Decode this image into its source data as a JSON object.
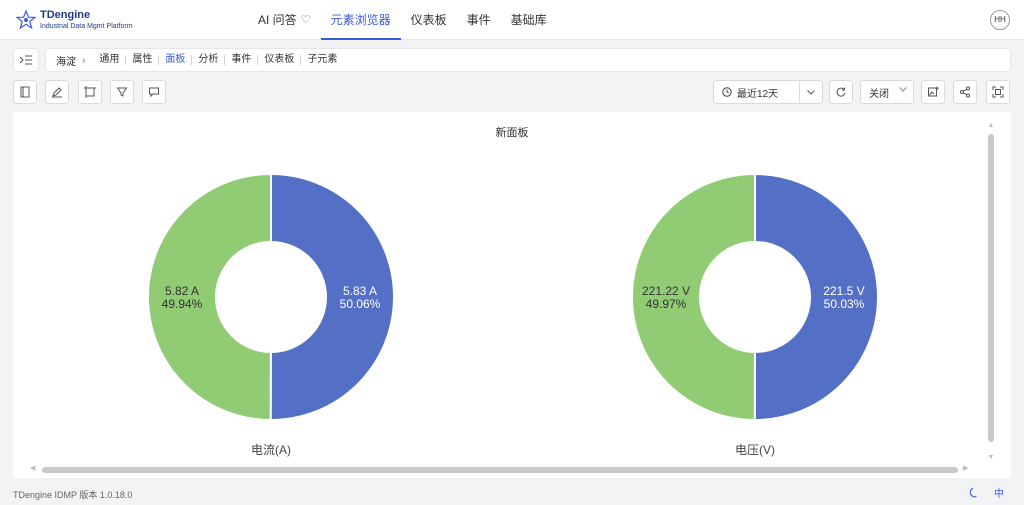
{
  "app": {
    "logo_title": "TDengine",
    "logo_subtitle": "Industrial Data Mgmt Platform",
    "avatar": "HH",
    "accent": "#3b5bdb"
  },
  "nav": {
    "items": [
      {
        "label": "AI 问答",
        "icon": "sparkle-icon"
      },
      {
        "label": "元素浏览器",
        "active": true
      },
      {
        "label": "仪表板"
      },
      {
        "label": "事件"
      },
      {
        "label": "基础库"
      }
    ]
  },
  "breadcrumb": {
    "root": "海淀",
    "tabs": [
      "通用",
      "属性",
      "面板",
      "分析",
      "事件",
      "仪表板",
      "子元素"
    ],
    "active_tab": "面板"
  },
  "toolbar": {
    "time_range": "最近12天",
    "refresh": "关闭"
  },
  "panel": {
    "title": "新面板"
  },
  "chart_data": [
    {
      "type": "pie",
      "title": "电流(A)",
      "slices": [
        {
          "label": "5.83 A",
          "value": 5.83,
          "percent": "50.06%",
          "color": "#5470c6"
        },
        {
          "label": "5.82 A",
          "value": 5.82,
          "percent": "49.94%",
          "color": "#91cc75"
        }
      ]
    },
    {
      "type": "pie",
      "title": "电压(V)",
      "slices": [
        {
          "label": "221.5 V",
          "value": 221.5,
          "percent": "50.03%",
          "color": "#5470c6"
        },
        {
          "label": "221.22 V",
          "value": 221.22,
          "percent": "49.97%",
          "color": "#91cc75"
        }
      ]
    }
  ],
  "footer": {
    "version": "TDengine IDMP 版本 1.0.18.0",
    "lang": "中"
  }
}
